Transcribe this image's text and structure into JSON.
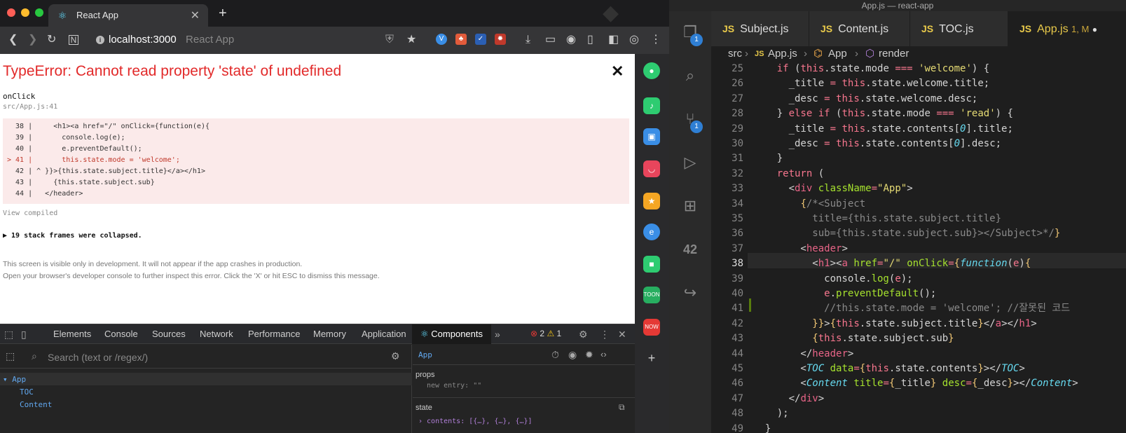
{
  "browser": {
    "tab_title": "React App",
    "url_host": "localhost:3000",
    "url_page_title": "React App",
    "error": {
      "title": "TypeError: Cannot read property 'state' of undefined",
      "function": "onClick",
      "location": "src/App.js:41",
      "code_lines": [
        "  38 |     <h1><a href=\"/\" onClick={function(e){",
        "  39 |       console.log(e);",
        "  40 |       e.preventDefault();",
        "> 41 |       this.state.mode = 'welcome';",
        "  42 | ^ }}>{this.state.subject.title}</a></h1>",
        "  43 |     {this.state.subject.sub}",
        "  44 |   </header>"
      ],
      "view_compiled": "View compiled",
      "frames_collapsed": "▶ 19 stack frames were collapsed.",
      "note_line1": "This screen is visible only in development. It will not appear if the app crashes in production.",
      "note_line2": "Open your browser's developer console to further inspect this error.  Click the 'X' or hit ESC to dismiss this message."
    },
    "devtools": {
      "tabs": [
        "Elements",
        "Console",
        "Sources",
        "Network",
        "Performance",
        "Memory",
        "Application",
        "Components"
      ],
      "errors": "2",
      "warnings": "1",
      "search_placeholder": "Search (text or /regex/)",
      "tree": [
        "▾ App",
        "TOC",
        "Content"
      ],
      "selected_component": "App",
      "props_header": "props",
      "props_entry": "new entry: \"\"",
      "state_header": "state",
      "state_entry": "› contents: [{…}, {…}, {…}]"
    }
  },
  "vscode": {
    "window_title": "App.js — react-app",
    "tabs": [
      {
        "label": "Subject.js"
      },
      {
        "label": "Content.js"
      },
      {
        "label": "TOC.js"
      },
      {
        "label": "App.js",
        "status": "1, M"
      }
    ],
    "breadcrumb": {
      "src": "src",
      "file": "App.js",
      "component": "App",
      "method": "render"
    },
    "badges": {
      "explorer": "1",
      "scm": "1"
    },
    "line_numbers": [
      "25",
      "26",
      "27",
      "28",
      "29",
      "30",
      "31",
      "32",
      "33",
      "34",
      "35",
      "36",
      "37",
      "38",
      "39",
      "40",
      "41",
      "42",
      "43",
      "44",
      "45",
      "46",
      "47",
      "48",
      "49"
    ]
  }
}
